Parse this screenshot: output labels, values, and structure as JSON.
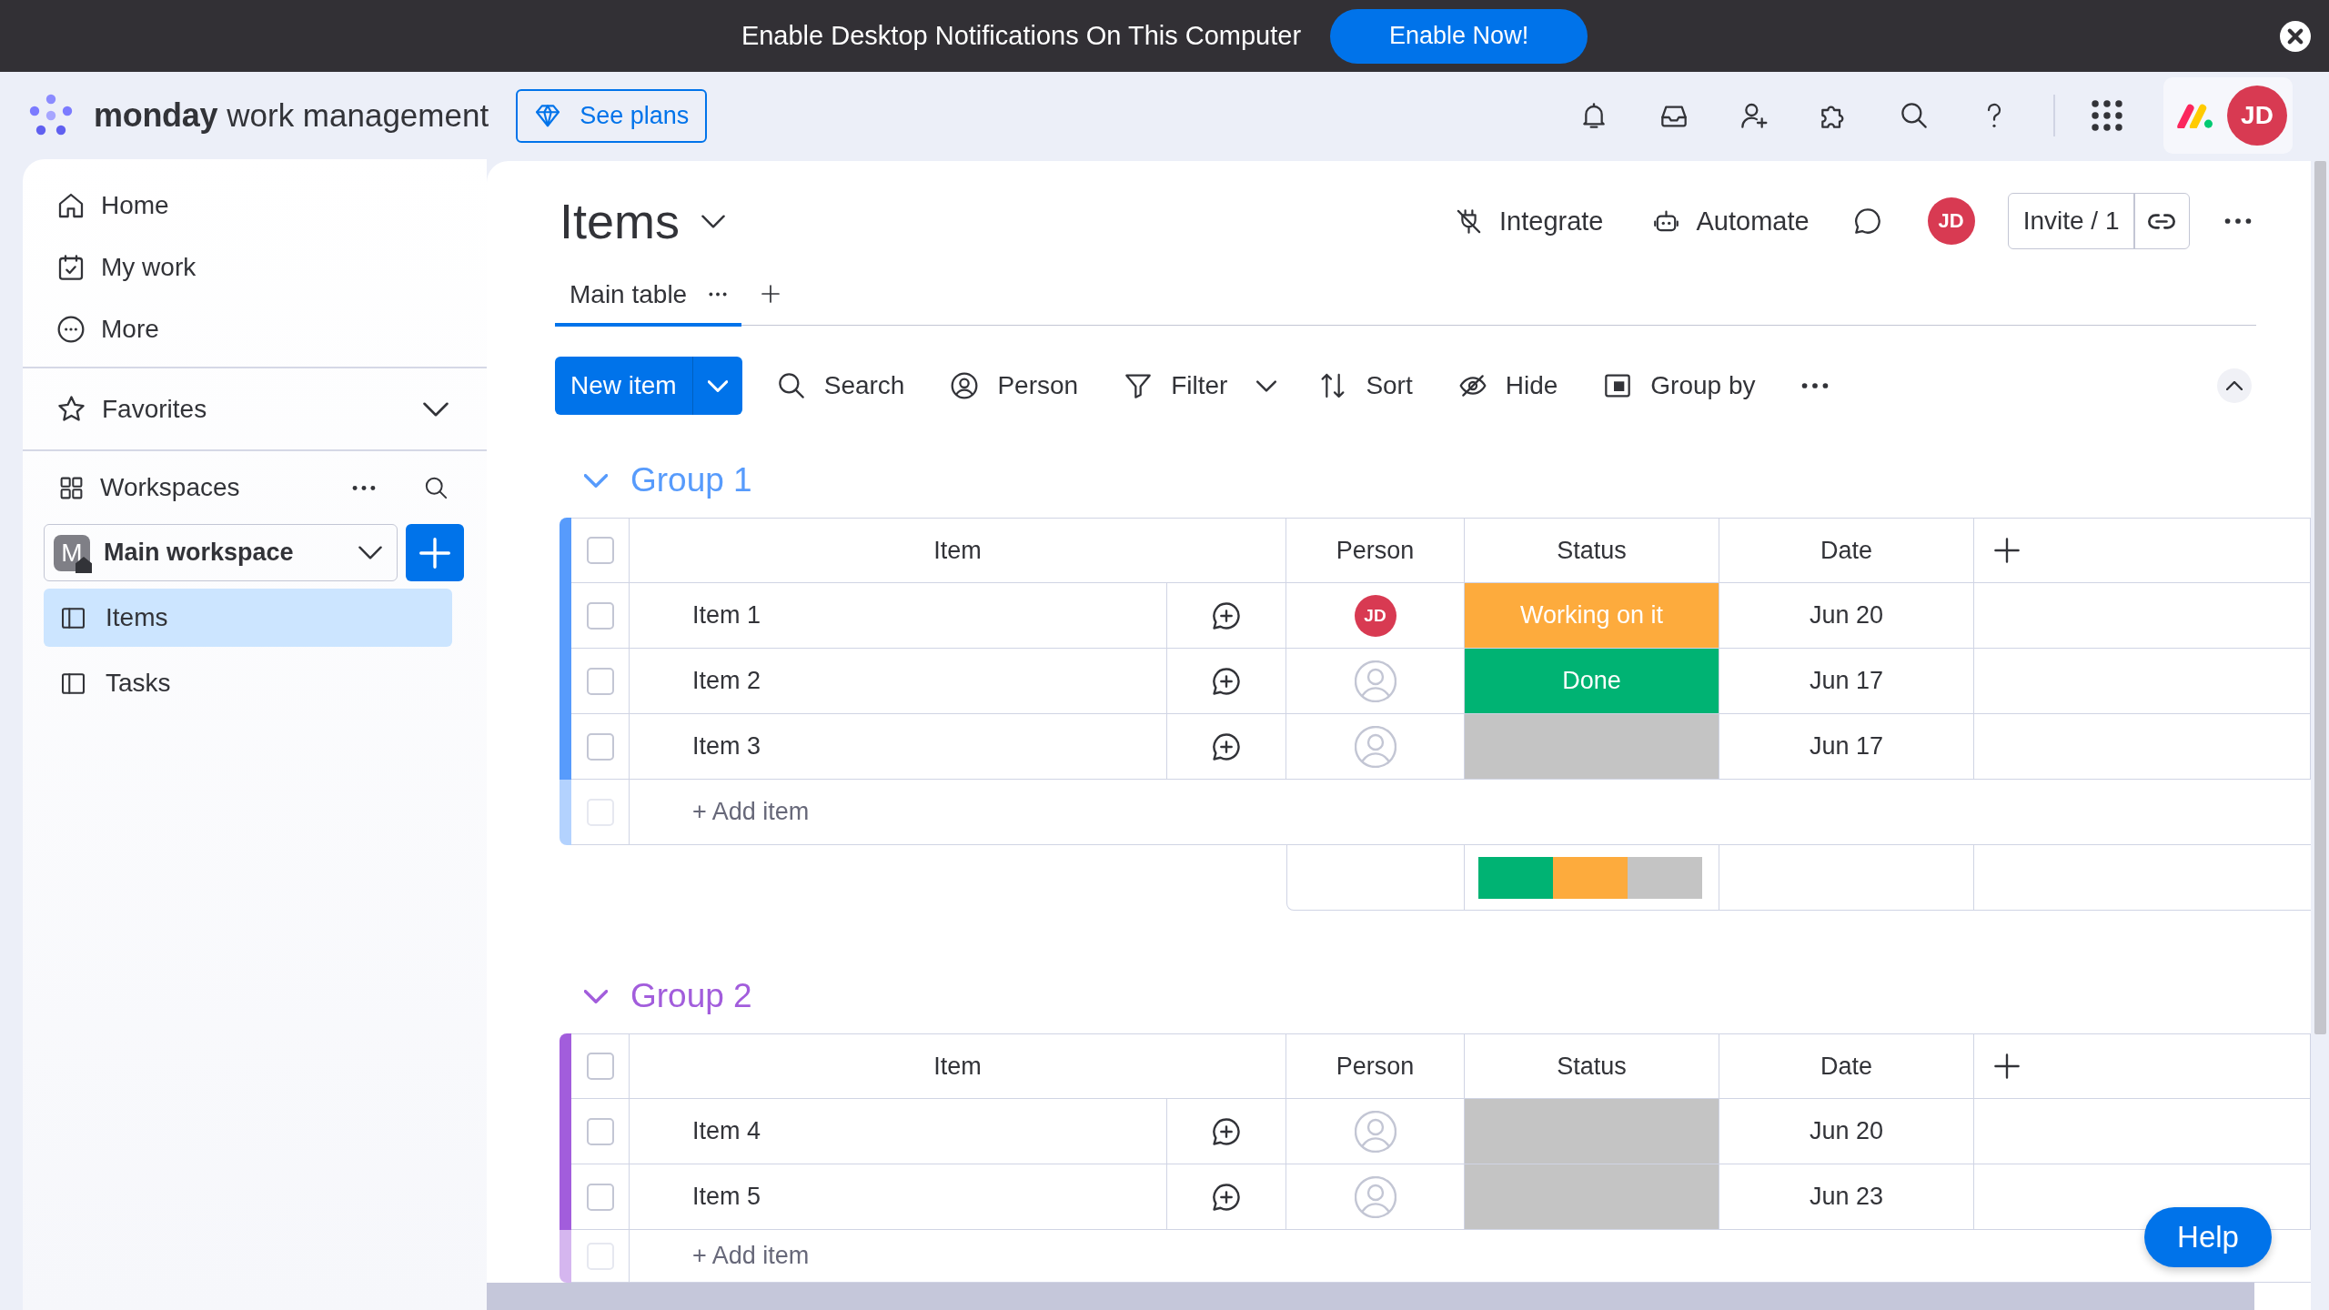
{
  "notification_bar": {
    "message": "Enable Desktop Notifications On This Computer",
    "button": "Enable Now!"
  },
  "header": {
    "brand": "monday",
    "product": "work management",
    "plans_button": "See plans",
    "avatar": "JD"
  },
  "sidebar": {
    "nav": [
      {
        "label": "Home"
      },
      {
        "label": "My work"
      },
      {
        "label": "More"
      }
    ],
    "favorites": {
      "label": "Favorites",
      "expanded": false
    },
    "workspaces": {
      "label": "Workspaces"
    },
    "workspace": {
      "badge": "M",
      "name": "Main workspace"
    },
    "boards": [
      {
        "label": "Items",
        "selected": true
      },
      {
        "label": "Tasks",
        "selected": false
      }
    ]
  },
  "board": {
    "title": "Items",
    "actions": [
      "Integrate",
      "Automate"
    ],
    "avatar": "JD",
    "invite": "Invite / 1",
    "tabs": [
      {
        "label": "Main table",
        "selected": true
      }
    ],
    "toolbar": {
      "new_item": "New item",
      "buttons": [
        {
          "label": "Search",
          "kind": "plain"
        },
        {
          "label": "Person",
          "kind": "plain"
        },
        {
          "label": "Filter",
          "kind": "split"
        },
        {
          "label": "Sort",
          "kind": "plain"
        },
        {
          "label": "Hide",
          "kind": "plain"
        },
        {
          "label": "Group by",
          "kind": "plain"
        }
      ]
    },
    "groups": [
      {
        "name": "Group 1",
        "color": "#579bfc",
        "expanded": true,
        "all_checked": false,
        "columns": [
          "Item",
          "Person",
          "Status",
          "Date"
        ],
        "rows": [
          {
            "name": "Item 1",
            "checked": false,
            "person": "JD",
            "status": {
              "label": "Working on it",
              "color": "#fdab3d"
            },
            "date": "Jun 20"
          },
          {
            "name": "Item 2",
            "checked": false,
            "status": {
              "label": "Done",
              "color": "#00b373"
            },
            "date": "Jun 17"
          },
          {
            "name": "Item 3",
            "checked": false,
            "status": {
              "color": "#c4c4c4"
            },
            "date": "Jun 17"
          }
        ],
        "add_item": {
          "placeholder": "+ Add item",
          "checked": false,
          "disabled": true
        },
        "summary": [
          {
            "color": "#00b373"
          },
          {
            "color": "#fdab3d"
          },
          {
            "color": "#c4c4c4"
          }
        ]
      },
      {
        "name": "Group 2",
        "color": "#a25ddc",
        "expanded": true,
        "all_checked": false,
        "columns": [
          "Item",
          "Person",
          "Status",
          "Date"
        ],
        "rows": [
          {
            "name": "Item 4",
            "checked": false,
            "status": {
              "color": "#c4c4c4"
            },
            "date": "Jun 20"
          },
          {
            "name": "Item 5",
            "checked": false,
            "status": {
              "color": "#c4c4c4"
            },
            "date": "Jun 23"
          }
        ],
        "add_item": {
          "placeholder": "+ Add item",
          "checked": false,
          "disabled": true
        }
      }
    ]
  },
  "help_button": "Help"
}
